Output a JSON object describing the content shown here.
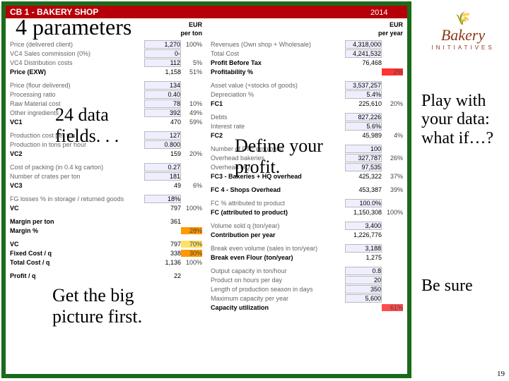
{
  "header": {
    "title": "CB 1 - BAKERY SHOP",
    "year": "2014"
  },
  "left": {
    "unit": "EUR",
    "unit2": "per ton",
    "r1": [
      {
        "l": "Price (delivered client)",
        "v": "1,270",
        "p": "100%"
      },
      {
        "l": "VC4 Sales commission (0%)",
        "v": "0-",
        "p": ""
      },
      {
        "l": "VC4 Distribution costs",
        "v": "112",
        "p": "5%"
      },
      {
        "l": "Price (EXW)",
        "b": true,
        "v": "1,158",
        "p": "51%"
      }
    ],
    "r2": [
      {
        "l": "Price (flour delivered)",
        "v": "134",
        "p": ""
      },
      {
        "l": "Processing ratio",
        "v": "0.40",
        "p": ""
      },
      {
        "l": "Raw Material cost",
        "v": "78",
        "p": "10%"
      },
      {
        "l": "Other ingredients",
        "v": "392",
        "p": "49%"
      },
      {
        "l": "VC1",
        "b": true,
        "v": "470",
        "p": "59%"
      }
    ],
    "r3": [
      {
        "l": "Production cost per ton",
        "v": "127",
        "p": ""
      },
      {
        "l": "Production in tons per hour",
        "v": "0.800",
        "p": ""
      },
      {
        "l": "VC2",
        "b": true,
        "v": "159",
        "p": "20%"
      }
    ],
    "r4": [
      {
        "l": "Cost of packing (in 0.4 kg carton)",
        "v": "0.27",
        "p": ""
      },
      {
        "l": "Number of crates per ton",
        "v": "181",
        "p": ""
      },
      {
        "l": "VC3",
        "b": true,
        "v": "49",
        "p": "6%"
      }
    ],
    "r5": [
      {
        "l": "FG losses % in storage / returned goods",
        "v": "18%",
        "p": ""
      },
      {
        "l": "VC",
        "b": true,
        "v": "797",
        "p": "100%"
      }
    ],
    "r6": [
      {
        "l": "Margin per ton",
        "b": true,
        "v": "361",
        "p": ""
      },
      {
        "l": "Margin %",
        "b": true,
        "v": "",
        "p": "28%",
        "hl": "o"
      }
    ],
    "r7": [
      {
        "l": "VC",
        "b": true,
        "v": "797",
        "p": "70%",
        "hl": "y"
      },
      {
        "l": "Fixed Cost / q",
        "b": true,
        "v": "338",
        "p": "30%",
        "hl": "o"
      },
      {
        "l": "Total Cost / q",
        "b": true,
        "v": "1,136",
        "p": "100%"
      }
    ],
    "r8": [
      {
        "l": "Profit / q",
        "b": true,
        "v": "22",
        "p": ""
      }
    ]
  },
  "right": {
    "unit": "EUR",
    "unit2": "per year",
    "r1": [
      {
        "l": "Revenues (Own shop + Wholesale)",
        "v": "4,318,000",
        "p": ""
      },
      {
        "l": "Total Cost",
        "v": "4,241,532",
        "p": ""
      },
      {
        "l": "Profit Before Tax",
        "b": true,
        "v": "76,468",
        "p": ""
      },
      {
        "l": "Profitability %",
        "b": true,
        "v": "",
        "p": "2%",
        "hl": "r"
      }
    ],
    "r2": [
      {
        "l": "Asset value (+stocks of goods)",
        "v": "3,537,257",
        "p": ""
      },
      {
        "l": "Depreciation %",
        "v": "5.4%",
        "p": ""
      },
      {
        "l": "FC1",
        "b": true,
        "v": "225,610",
        "p": "20%"
      }
    ],
    "r3": [
      {
        "l": "Debts",
        "v": "827,226",
        "p": ""
      },
      {
        "l": "Interest rate",
        "v": "5.6%",
        "p": ""
      },
      {
        "l": "FC2",
        "b": true,
        "v": "45,989",
        "p": "4%"
      }
    ],
    "r4": [
      {
        "l": "Number of FTE employed",
        "v": "100",
        "p": ""
      },
      {
        "l": "Overhead bakeries",
        "v": "327,787",
        "p": "26%"
      },
      {
        "l": "Overhead HQ",
        "v": "97,535",
        "p": ""
      },
      {
        "l": "FC3 - Bakeries + HQ overhead",
        "b": true,
        "v": "425,322",
        "p": "37%"
      }
    ],
    "r5": [
      {
        "l": "FC 4 - Shops Overhead",
        "b": true,
        "v": "453,387",
        "p": "39%"
      }
    ],
    "r6": [
      {
        "l": "FC % attributed to product",
        "v": "100.0%",
        "p": ""
      },
      {
        "l": "FC (attributed to product)",
        "b": true,
        "v": "1,150,308",
        "p": "100%"
      }
    ],
    "r7": [
      {
        "l": "Volume sold q (ton/year)",
        "v": "3,400",
        "p": ""
      },
      {
        "l": "Contribution per year",
        "b": true,
        "v": "1,226,776",
        "p": ""
      }
    ],
    "r8": [
      {
        "l": "Break even volume (sales in ton/year)",
        "v": "3,188",
        "p": ""
      },
      {
        "l": "Break even Flour (ton/year)",
        "b": true,
        "v": "1,275",
        "p": ""
      }
    ],
    "r9": [
      {
        "l": "Output capacity in ton/hour",
        "v": "0.8",
        "p": ""
      },
      {
        "l": "Product on hours per day",
        "v": "20",
        "p": ""
      },
      {
        "l": "Length of production season in days",
        "v": "350",
        "p": ""
      },
      {
        "l": "Maximum capacity per year",
        "v": "5,600",
        "p": ""
      },
      {
        "l": "Capacity utilization",
        "b": true,
        "v": "",
        "p": "61%",
        "hl": "r2"
      }
    ]
  },
  "overlay": {
    "o1": "4 parameters",
    "o2": "24 data fields. . .",
    "o3": "Define your profit.",
    "o4": "Get the big picture first.",
    "r1": "Play with your data: what if…?",
    "r2": "Be sure",
    "page": "19",
    "logo": "Bakery",
    "logosub": "INITIATIVES"
  }
}
